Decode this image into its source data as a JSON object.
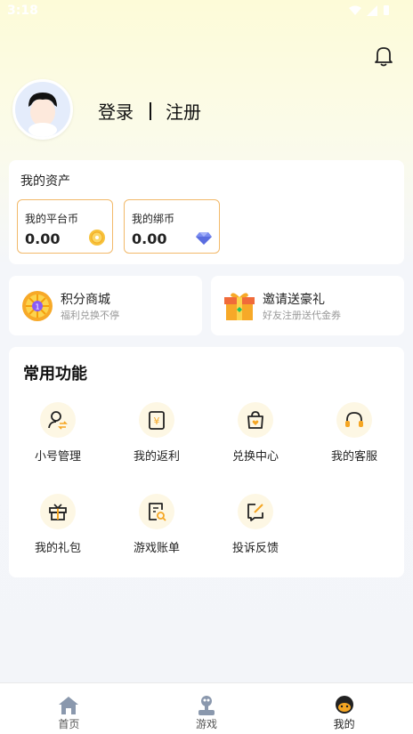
{
  "status_bar": {
    "time": "3:18"
  },
  "user": {
    "login_label": "登录",
    "register_label": "注册"
  },
  "assets": {
    "title": "我的资产",
    "platform_coin": {
      "label": "我的平台币",
      "value": "0.00"
    },
    "bound_coin": {
      "label": "我的绑币",
      "value": "0.00"
    }
  },
  "promos": [
    {
      "title": "积分商城",
      "subtitle": "福利兑换不停"
    },
    {
      "title": "邀请送豪礼",
      "subtitle": "好友注册送代金券"
    }
  ],
  "functions": {
    "title": "常用功能",
    "items": [
      {
        "label": "小号管理",
        "icon": "account-switch-icon"
      },
      {
        "label": "我的返利",
        "icon": "rebate-icon"
      },
      {
        "label": "兑换中心",
        "icon": "exchange-bag-icon"
      },
      {
        "label": "我的客服",
        "icon": "headset-icon"
      },
      {
        "label": "我的礼包",
        "icon": "gift-box-icon"
      },
      {
        "label": "游戏账单",
        "icon": "bill-search-icon"
      },
      {
        "label": "投诉反馈",
        "icon": "feedback-edit-icon"
      }
    ]
  },
  "tabs": [
    {
      "label": "首页",
      "icon": "home-icon"
    },
    {
      "label": "游戏",
      "icon": "joystick-icon"
    },
    {
      "label": "我的",
      "icon": "profile-icon",
      "active": true
    }
  ],
  "colors": {
    "accent": "#f5a623",
    "coin_border": "#f2b96a",
    "icon_bg": "#fdf7e4"
  }
}
